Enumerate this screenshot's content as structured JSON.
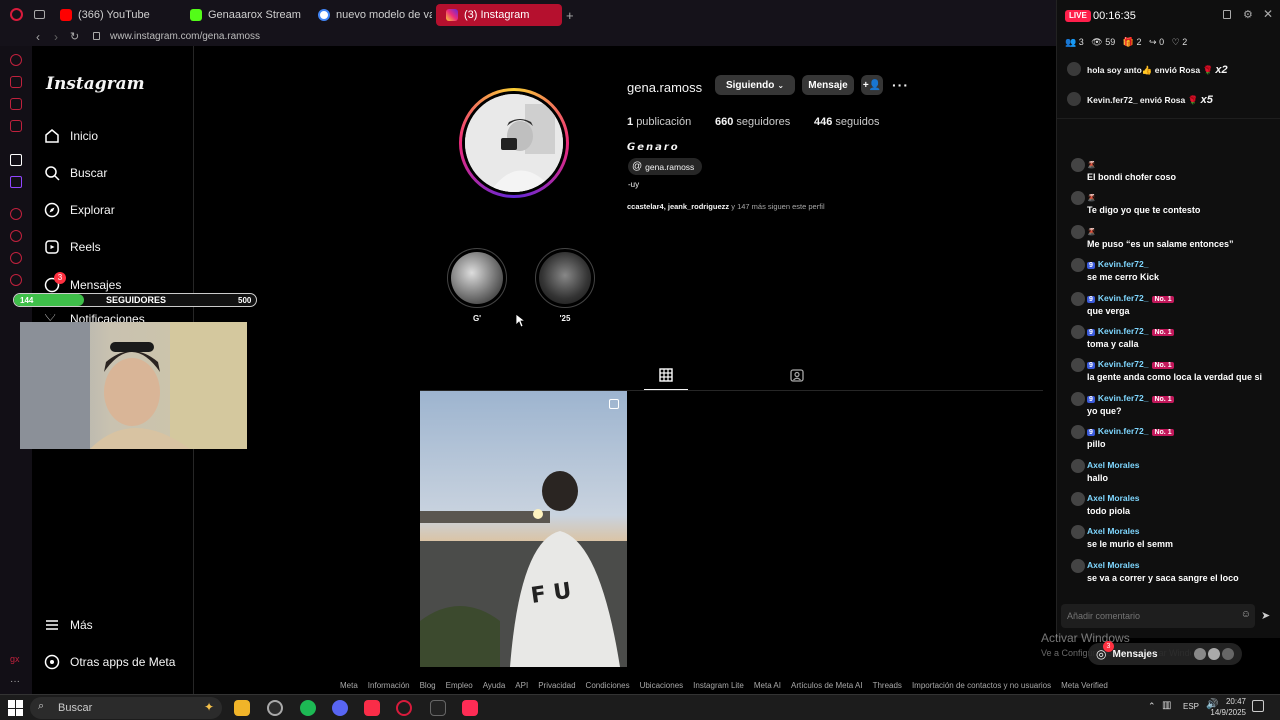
{
  "browser": {
    "tabs": [
      {
        "label": "(366) YouTube",
        "color": "#ff0000"
      },
      {
        "label": "Genaaarox Stream - Watc",
        "color": "#53fc18"
      },
      {
        "label": "nuevo modelo de vans - ",
        "color": "#4285f4"
      },
      {
        "label": "(3) Instagram",
        "color": "#e1306c"
      }
    ],
    "new_tab": "+",
    "url": "www.instagram.com/gena.ramoss"
  },
  "instagram": {
    "logo": "Instagram",
    "nav": {
      "inicio": "Inicio",
      "buscar": "Buscar",
      "explorar": "Explorar",
      "reels": "Reels",
      "mensajes": "Mensajes",
      "mensajes_badge": "3",
      "notificaciones": "Notificaciones",
      "mas": "Más",
      "otras_apps": "Otras apps de Meta"
    },
    "profile": {
      "username": "gena.ramoss",
      "following_button": "Siguiendo",
      "message_button": "Mensaje",
      "posts_count": "1",
      "posts_label": "publicación",
      "followers_count": "660",
      "followers_label": "seguidores",
      "following_count": "446",
      "following_label": "seguidos",
      "display_name": "𝙂𝙚𝙣𝙖𝙧𝙤",
      "threads_handle": "gena.ramoss",
      "bio": "-uy",
      "followed_by_names": "ccastelar4, jeank_rodriguezz",
      "followed_by_rest": "y 147 más siguen este perfil"
    },
    "highlights": [
      {
        "label": "G'"
      },
      {
        "label": "'25"
      }
    ],
    "footer_links": [
      "Meta",
      "Información",
      "Blog",
      "Empleo",
      "Ayuda",
      "API",
      "Privacidad",
      "Condiciones",
      "Ubicaciones",
      "Instagram Lite",
      "Meta AI",
      "Artículos de Meta AI",
      "Threads",
      "Importación de contactos y no usuarios",
      "Meta Verified"
    ]
  },
  "overlay": {
    "goal_current": "144",
    "goal_label": "SEGUIDORES",
    "goal_target": "500",
    "goal_progress": 0.288
  },
  "stream": {
    "live_badge": "LIVE",
    "timer": "00:16:35",
    "stats": {
      "users": "3",
      "viewers": "59",
      "gifts": "2",
      "shares": "0",
      "likes": "2"
    },
    "gift_events": [
      {
        "text": "hola soy anto👍 envió Rosa",
        "mult": "x2"
      },
      {
        "text": "Kevin.fer72_ envió Rosa",
        "mult": "x5"
      }
    ],
    "messages": [
      {
        "user": "",
        "text": "El bondi chofer coso"
      },
      {
        "user": "",
        "text": "Te digo yo que te contesto"
      },
      {
        "user": "",
        "text": "Me puso “es un salame entonces”"
      },
      {
        "user": "Kevin.fer72_",
        "level": "9",
        "rank": "",
        "text": "se me cerro Kick"
      },
      {
        "user": "Kevin.fer72_",
        "level": "9",
        "rank": "No. 1",
        "text": "que verga"
      },
      {
        "user": "Kevin.fer72_",
        "level": "9",
        "rank": "No. 1",
        "text": "toma y calla"
      },
      {
        "user": "Kevin.fer72_",
        "level": "9",
        "rank": "No. 1",
        "text": "la gente anda como loca la verdad que si"
      },
      {
        "user": "Kevin.fer72_",
        "level": "9",
        "rank": "No. 1",
        "text": "yo que?"
      },
      {
        "user": "Kevin.fer72_",
        "level": "9",
        "rank": "No. 1",
        "text": "pillo"
      },
      {
        "user": "Axel Morales",
        "text": "hallo"
      },
      {
        "user": "Axel Morales",
        "text": "todo piola"
      },
      {
        "user": "Axel Morales",
        "text": "se le murio el semm"
      },
      {
        "user": "Axel Morales",
        "text": "se va a correr y saca sangre el loco"
      }
    ],
    "comment_placeholder": "Añadir comentario"
  },
  "floating": {
    "activate_windows": "Activar Windows",
    "activate_sub": "Ve a Configuración para activar Windows.",
    "messages_pill": "Mensajes",
    "messages_badge": "3"
  },
  "taskbar": {
    "search_placeholder": "Buscar",
    "lang": "ESP",
    "time": "20:47",
    "date": "14/9/2025"
  }
}
